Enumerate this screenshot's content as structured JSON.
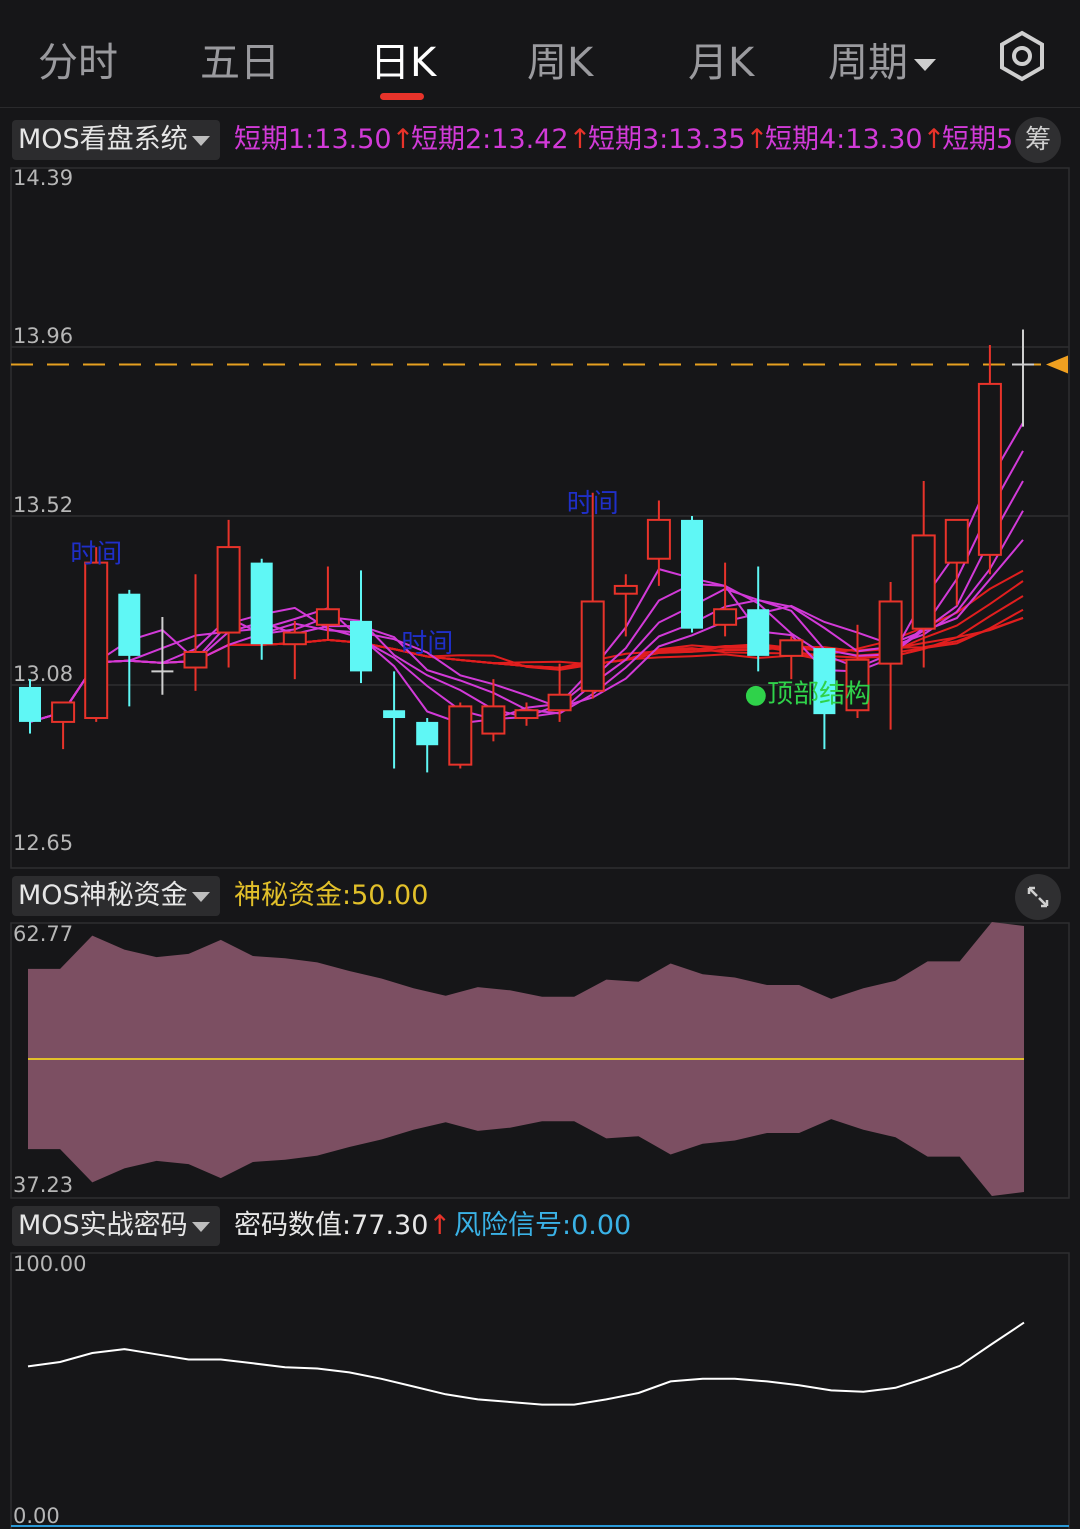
{
  "tabs": [
    "分时",
    "五日",
    "日K",
    "周K",
    "月K",
    "周期"
  ],
  "active_tab": "日K",
  "colors": {
    "up": "#e8332a",
    "down": "#5ff7f5",
    "accent": "#e8332a",
    "short_ma": "#d23ad8",
    "long_ma": "#e11e1e",
    "line": "#ffffff",
    "fund_area": "#7c4f62",
    "fund_mid": "#e2c02a"
  },
  "price_panel": {
    "selector": "MOS看盘系统",
    "legend": [
      {
        "label": "短期1:",
        "value": "13.50"
      },
      {
        "label": "短期2:",
        "value": "13.42"
      },
      {
        "label": "短期3:",
        "value": "13.35"
      },
      {
        "label": "短期4:",
        "value": "13.30"
      },
      {
        "label": "短期5",
        "value": ""
      }
    ],
    "chip_button": "筹",
    "y_labels": [
      "14.39",
      "13.96",
      "13.52",
      "13.08",
      "12.65"
    ],
    "annotations": [
      {
        "text": "时间",
        "candle": 2,
        "price": 13.4
      },
      {
        "text": "时间",
        "candle": 17,
        "price": 13.53
      },
      {
        "text": "时间",
        "candle": 12,
        "price": 13.17
      },
      {
        "text": "●顶部结构",
        "candle": 23.5,
        "price": 13.04
      }
    ]
  },
  "chart_data": [
    {
      "type": "candlestick",
      "y_range": [
        12.65,
        14.39
      ],
      "current_price": 13.91,
      "candles": [
        {
          "o": 13.08,
          "h": 13.1,
          "l": 12.96,
          "c": 12.99
        },
        {
          "o": 12.99,
          "h": 13.04,
          "l": 12.92,
          "c": 13.04
        },
        {
          "o": 13.0,
          "h": 13.44,
          "l": 12.99,
          "c": 13.4
        },
        {
          "o": 13.32,
          "h": 13.33,
          "l": 13.03,
          "c": 13.16
        },
        {
          "o": 13.12,
          "h": 13.26,
          "l": 13.06,
          "c": 13.12
        },
        {
          "o": 13.13,
          "h": 13.37,
          "l": 13.07,
          "c": 13.17
        },
        {
          "o": 13.22,
          "h": 13.51,
          "l": 13.13,
          "c": 13.44
        },
        {
          "o": 13.4,
          "h": 13.41,
          "l": 13.15,
          "c": 13.19
        },
        {
          "o": 13.19,
          "h": 13.25,
          "l": 13.1,
          "c": 13.22
        },
        {
          "o": 13.24,
          "h": 13.39,
          "l": 13.2,
          "c": 13.28
        },
        {
          "o": 13.25,
          "h": 13.38,
          "l": 13.09,
          "c": 13.12
        },
        {
          "o": 13.02,
          "h": 13.12,
          "l": 12.87,
          "c": 13.0
        },
        {
          "o": 12.99,
          "h": 13.0,
          "l": 12.86,
          "c": 12.93
        },
        {
          "o": 12.88,
          "h": 13.04,
          "l": 12.87,
          "c": 13.03
        },
        {
          "o": 12.96,
          "h": 13.1,
          "l": 12.94,
          "c": 13.03
        },
        {
          "o": 13.0,
          "h": 13.04,
          "l": 12.98,
          "c": 13.02
        },
        {
          "o": 13.02,
          "h": 13.14,
          "l": 12.99,
          "c": 13.06
        },
        {
          "o": 13.07,
          "h": 13.58,
          "l": 13.05,
          "c": 13.3
        },
        {
          "o": 13.32,
          "h": 13.37,
          "l": 13.21,
          "c": 13.34
        },
        {
          "o": 13.41,
          "h": 13.56,
          "l": 13.34,
          "c": 13.51
        },
        {
          "o": 13.51,
          "h": 13.52,
          "l": 13.22,
          "c": 13.23
        },
        {
          "o": 13.24,
          "h": 13.4,
          "l": 13.21,
          "c": 13.28
        },
        {
          "o": 13.28,
          "h": 13.39,
          "l": 13.12,
          "c": 13.16
        },
        {
          "o": 13.16,
          "h": 13.21,
          "l": 13.1,
          "c": 13.2
        },
        {
          "o": 13.18,
          "h": 13.18,
          "l": 12.92,
          "c": 13.01
        },
        {
          "o": 13.02,
          "h": 13.24,
          "l": 13.0,
          "c": 13.15
        },
        {
          "o": 13.14,
          "h": 13.35,
          "l": 12.97,
          "c": 13.3
        },
        {
          "o": 13.23,
          "h": 13.61,
          "l": 13.13,
          "c": 13.47
        },
        {
          "o": 13.4,
          "h": 13.46,
          "l": 13.29,
          "c": 13.51
        },
        {
          "o": 13.42,
          "h": 13.96,
          "l": 13.37,
          "c": 13.86
        },
        {
          "o": 13.91,
          "h": 14.0,
          "l": 13.75,
          "c": 13.91
        }
      ]
    },
    {
      "type": "area",
      "name": "神秘资金",
      "current_value": "50.00",
      "y_range": [
        37.23,
        62.77
      ],
      "values": [
        58.4,
        58.4,
        61.5,
        60.2,
        59.5,
        59.8,
        61.1,
        59.6,
        59.4,
        59.0,
        58.2,
        57.5,
        56.6,
        55.9,
        56.7,
        56.4,
        55.8,
        55.8,
        57.4,
        57.2,
        58.9,
        57.9,
        57.6,
        56.9,
        56.9,
        55.6,
        56.6,
        57.3,
        59.1,
        59.1,
        62.77,
        62.4
      ]
    },
    {
      "type": "line",
      "name": "密码数值",
      "current_value": "77.30",
      "risk_signal": "0.00",
      "y_range": [
        0,
        100
      ],
      "values": [
        60.3,
        62.0,
        65.5,
        67.0,
        65.0,
        63.0,
        63.0,
        61.5,
        60.0,
        59.5,
        58.0,
        55.5,
        52.5,
        49.5,
        47.5,
        46.5,
        45.5,
        45.5,
        47.5,
        50.0,
        54.5,
        55.5,
        55.5,
        54.5,
        53.0,
        51.0,
        50.5,
        52.0,
        56.0,
        60.5,
        69.0,
        77.3
      ]
    }
  ],
  "fund_panel": {
    "selector": "MOS神秘资金",
    "label": "神秘资金:",
    "value": "50.00",
    "y_labels": [
      "62.77",
      "37.23"
    ]
  },
  "code_panel": {
    "selector": "MOS实战密码",
    "code_label": "密码数值:",
    "code_value": "77.30",
    "risk_label": "风险信号:",
    "risk_value": "0.00",
    "y_labels": [
      "100.00",
      "0.00"
    ]
  }
}
